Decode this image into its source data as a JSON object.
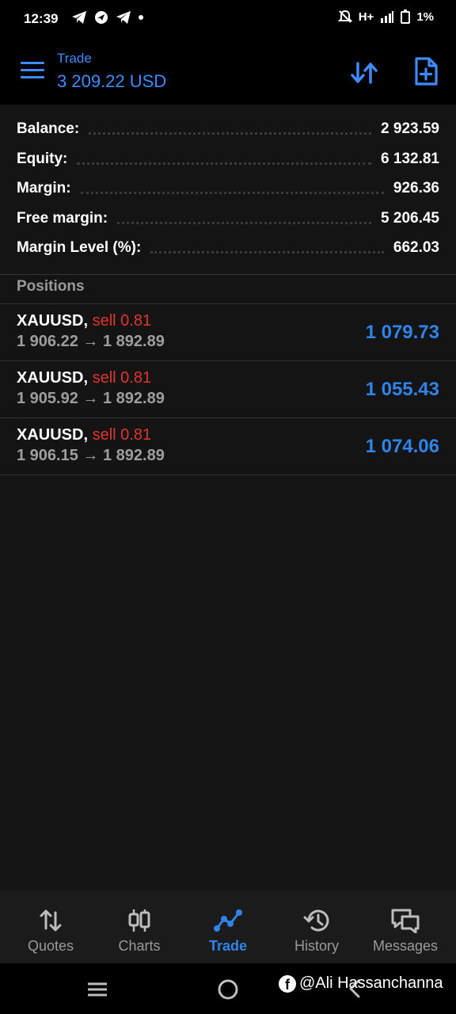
{
  "status_bar": {
    "time": "12:39",
    "network": "H+",
    "battery": "1%"
  },
  "header": {
    "title": "Trade",
    "balance": "3 209.22 USD",
    "accent_color": "#3d8bfd"
  },
  "summary": [
    {
      "label": "Balance:",
      "value": "2 923.59"
    },
    {
      "label": "Equity:",
      "value": "6 132.81"
    },
    {
      "label": "Margin:",
      "value": "926.36"
    },
    {
      "label": "Free margin:",
      "value": "5 206.45"
    },
    {
      "label": "Margin Level (%):",
      "value": "662.03"
    }
  ],
  "positions": {
    "header": "Positions",
    "items": [
      {
        "symbol": "XAUUSD,",
        "side": "sell 0.81",
        "open_price": "1 906.22",
        "arrow": "→",
        "current_price": "1 892.89",
        "profit": "1 079.73"
      },
      {
        "symbol": "XAUUSD,",
        "side": "sell 0.81",
        "open_price": "1 905.92",
        "arrow": "→",
        "current_price": "1 892.89",
        "profit": "1 055.43"
      },
      {
        "symbol": "XAUUSD,",
        "side": "sell 0.81",
        "open_price": "1 906.15",
        "arrow": "→",
        "current_price": "1 892.89",
        "profit": "1 074.06"
      }
    ]
  },
  "bottom_nav": [
    {
      "label": "Quotes",
      "icon": "quotes-icon",
      "active": false
    },
    {
      "label": "Charts",
      "icon": "charts-icon",
      "active": false
    },
    {
      "label": "Trade",
      "icon": "trade-icon",
      "active": true
    },
    {
      "label": "History",
      "icon": "history-icon",
      "active": false
    },
    {
      "label": "Messages",
      "icon": "messages-icon",
      "active": false
    }
  ],
  "watermark": {
    "text": "@Ali Hassanchanna",
    "logo": "f"
  },
  "colors": {
    "profit": "#2f84ec",
    "sell": "#e0352f",
    "active_nav": "#2f84ec"
  }
}
